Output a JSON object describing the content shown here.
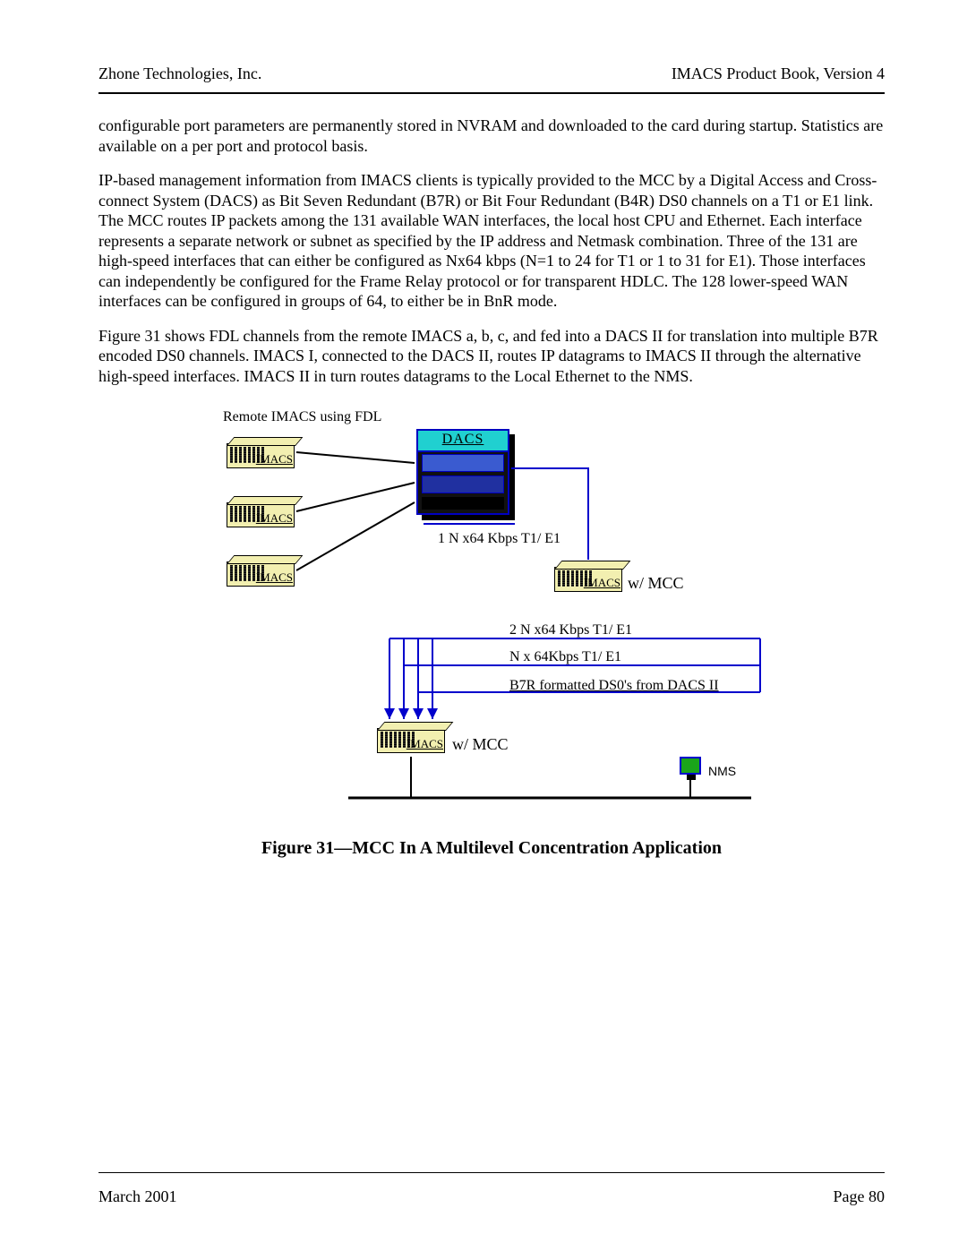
{
  "header": {
    "left": "Zhone Technologies, Inc.",
    "right": "IMACS Product Book, Version 4"
  },
  "paragraphs": {
    "p1": "configurable port parameters are permanently stored in NVRAM and downloaded to the card during startup. Statistics are available on a per port and protocol basis.",
    "p2": "IP-based management information from IMACS clients is typically provided to the MCC by a Digital Access and Cross-connect System (DACS) as Bit Seven Redundant (B7R) or Bit Four Redundant (B4R) DS0 channels on a T1 or E1 link.  The MCC routes IP packets among the 131 available WAN interfaces, the local host CPU and Ethernet. Each interface represents a separate network or subnet as specified by the IP address and Netmask combination. Three of the 131 are high-speed interfaces that can either be configured as Nx64 kbps (N=1 to 24 for T1 or 1 to 31 for E1).  Those interfaces can independently be configured for the Frame Relay protocol or for transparent HDLC. The 128 lower-speed WAN interfaces can be configured in groups of 64, to either be in BnR mode.",
    "p3": "Figure 31 shows FDL channels from the remote IMACS a, b, c, and fed into a DACS II for translation into multiple B7R encoded DS0 channels.  IMACS I, connected to the DACS II, routes IP datagrams to IMACS II through the alternative high-speed interfaces.  IMACS II in turn routes datagrams to the Local Ethernet to the NMS."
  },
  "diagram": {
    "title": "Remote IMACS using FDL",
    "dacs_label": "DACS",
    "imacs_label": "IMACS",
    "wmcc": "w/ MCC",
    "link1": "1 N x64 Kbps T1/ E1",
    "link2": "2 N x64 Kbps T1/ E1",
    "link3": "N x 64Kbps T1/ E1",
    "link4": "B7R formatted DS0's from DACS II",
    "nms": "NMS"
  },
  "figure_caption": "Figure 31—MCC In A Multilevel Concentration Application",
  "footer": {
    "left": "March 2001",
    "right": "Page 80"
  }
}
